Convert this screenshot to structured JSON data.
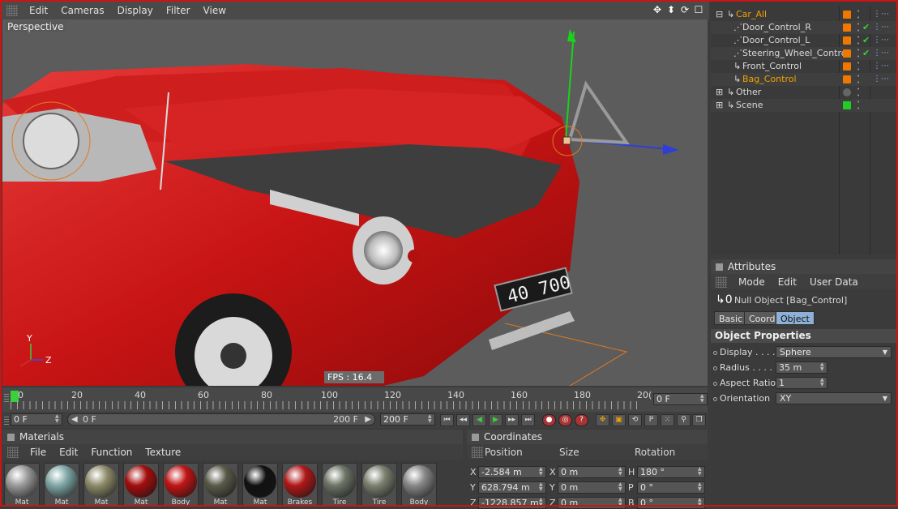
{
  "menubar": {
    "items": [
      "Edit",
      "Cameras",
      "Display",
      "Filter",
      "View"
    ]
  },
  "viewport": {
    "label": "Perspective",
    "fps": "FPS : 16.4",
    "plate": "40 700",
    "axis_y": "Y",
    "axis_z": "Z"
  },
  "timeline": {
    "ticks": [
      "0",
      "20",
      "40",
      "60",
      "80",
      "100",
      "120",
      "140",
      "160",
      "180",
      "20("
    ],
    "current_frame": "0 F"
  },
  "controls": {
    "start": "0 F",
    "range_start": "0 F",
    "range_end": "200 F",
    "end": "200 F"
  },
  "materials": {
    "title": "Materials",
    "menu": [
      "File",
      "Edit",
      "Function",
      "Texture"
    ],
    "items": [
      {
        "label": "Mat",
        "color": "#9a9a9a"
      },
      {
        "label": "Mat",
        "color": "#7fa6a6"
      },
      {
        "label": "Mat",
        "color": "#8d8b6a"
      },
      {
        "label": "Mat",
        "color": "#a40d0d"
      },
      {
        "label": "Body",
        "color": "#c01414"
      },
      {
        "label": "Mat",
        "color": "#5a5a4a"
      },
      {
        "label": "Mat",
        "color": "#111111"
      },
      {
        "label": "Brakes",
        "color": "#b01818"
      },
      {
        "label": "Tire",
        "color": "#6d7466"
      },
      {
        "label": "Tire",
        "color": "#7b806f"
      },
      {
        "label": "Body",
        "color": "#888888"
      }
    ]
  },
  "coordinates": {
    "title": "Coordinates",
    "headers": [
      "Position",
      "Size",
      "Rotation"
    ],
    "rows": [
      {
        "axis": "X",
        "pos": "-2.584 m",
        "saxis": "X",
        "size": "0 m",
        "raxis": "H",
        "rot": "180 °"
      },
      {
        "axis": "Y",
        "pos": "628.794 m",
        "saxis": "Y",
        "size": "0 m",
        "raxis": "P",
        "rot": "0 °"
      },
      {
        "axis": "Z",
        "pos": "-1228.857 m",
        "saxis": "Z",
        "size": "0 m",
        "raxis": "B",
        "rot": "0 °"
      }
    ]
  },
  "objects": {
    "items": [
      {
        "name": "Car_All",
        "color": "#f0a000",
        "tag": "#f07800",
        "check": false
      },
      {
        "name": "Door_Control_R",
        "color": "#d8d8d8",
        "tag": "#f07800",
        "check": true
      },
      {
        "name": "Door_Control_L",
        "color": "#d8d8d8",
        "tag": "#f07800",
        "check": true
      },
      {
        "name": "Steering_Wheel_Control",
        "color": "#d8d8d8",
        "tag": "#f07800",
        "check": true
      },
      {
        "name": "Front_Control",
        "color": "#d8d8d8",
        "tag": "#f07800",
        "check": false
      },
      {
        "name": "Bag_Control",
        "color": "#f0a000",
        "tag": "#f07800",
        "check": false
      },
      {
        "name": "Other",
        "color": "#d8d8d8",
        "tag": "#666666",
        "check": false
      },
      {
        "name": "Scene",
        "color": "#d8d8d8",
        "tag": "#22cc22",
        "check": false
      }
    ]
  },
  "attributes": {
    "title": "Attributes",
    "menu": [
      "Mode",
      "Edit",
      "User Data"
    ],
    "object_name": "Null Object [Bag_Control]",
    "tabs": [
      "Basic",
      "Coord.",
      "Object"
    ],
    "section": "Object Properties",
    "props": [
      {
        "label": "Display . . . .",
        "value": "Sphere"
      },
      {
        "label": "Radius . . . .",
        "value": "35 m"
      },
      {
        "label": "Aspect Ratio",
        "value": "1"
      },
      {
        "label": "Orientation",
        "value": "XY"
      }
    ]
  }
}
